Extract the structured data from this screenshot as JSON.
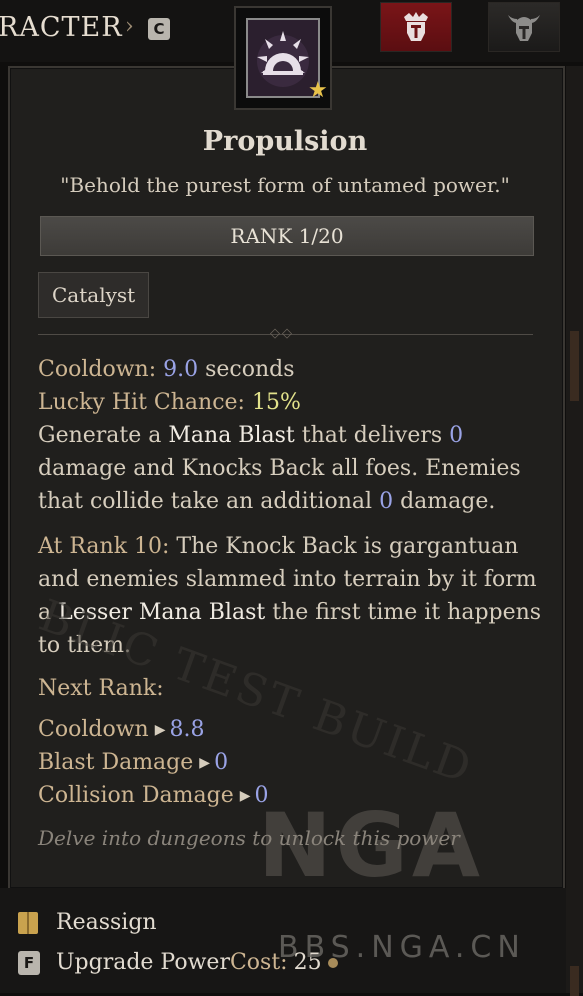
{
  "header": {
    "window_title": "RACTER",
    "separator": "›",
    "hotkey": "C"
  },
  "skill": {
    "name": "Propulsion",
    "quote": "\"Behold the purest form of untamed power.\"",
    "rank": "RANK 1/20",
    "tag": "Catalyst"
  },
  "stats": {
    "cooldown_label": "Cooldown:",
    "cooldown_value": "9.0",
    "cooldown_unit": "seconds",
    "lucky_label": "Lucky Hit Chance:",
    "lucky_value": "15%"
  },
  "description": {
    "l1_a": "Generate a ",
    "l1_em": "Mana Blast",
    "l1_b": " that delivers ",
    "l1_num": "0",
    "l2": "damage and Knocks Back all foes. Enemies",
    "l3_a": "that collide take an additional ",
    "l3_num": "0",
    "l3_b": " damage."
  },
  "rank10": {
    "label": "At Rank 10:",
    "l1": " The Knock Back is gargantuan",
    "l2": "and enemies slammed into terrain by it form",
    "l3_a": "a ",
    "l3_em": "Lesser Mana Blast",
    "l3_b": " the first time it happens",
    "l4": "to them."
  },
  "next_rank": {
    "heading": "Next Rank:",
    "rows": [
      {
        "label": "Cooldown",
        "value": "8.8"
      },
      {
        "label": "Blast Damage",
        "value": "0"
      },
      {
        "label": "Collision Damage",
        "value": "0"
      }
    ]
  },
  "hint": "Delve into dungeons to unlock this power",
  "watermarks": {
    "diagonal": "BLIC TEST BUILD",
    "logo": "NGA",
    "url": "BBS.NGA.CN"
  },
  "footer": {
    "reassign_label": "Reassign",
    "upgrade_key": "F",
    "upgrade_label": "Upgrade Power",
    "cost_label": " Cost:",
    "cost_value": "25"
  },
  "colors": {
    "label": "#cdb592",
    "number": "#9aa3e6",
    "lucky_value": "#e2e28b",
    "tab_active": "#7a1518"
  },
  "icons": [
    "helmet-crown-icon",
    "horned-helmet-icon",
    "skill-sunburst-icon",
    "favorite-star-icon",
    "reassign-book-icon",
    "triangle-right-icon",
    "coin-icon"
  ]
}
